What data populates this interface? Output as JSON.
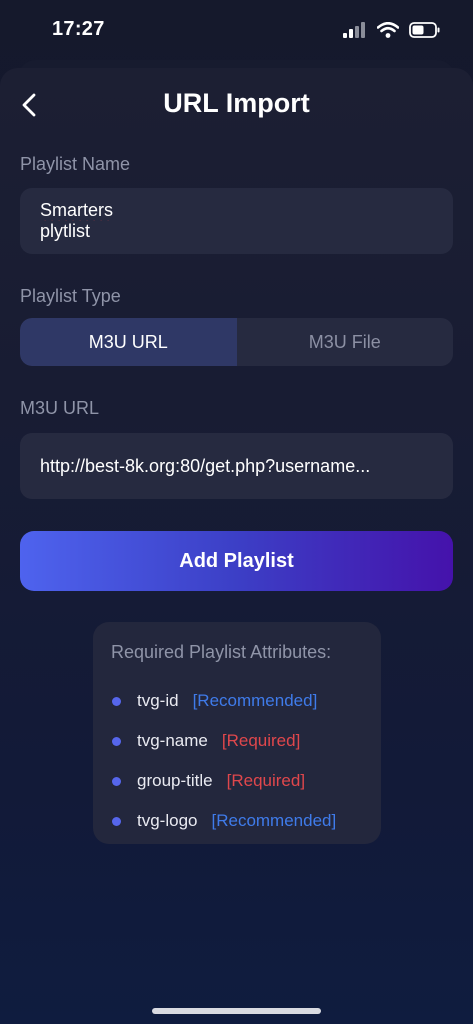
{
  "status_bar": {
    "time": "17:27"
  },
  "header": {
    "title": "URL Import",
    "back_icon": "chevron-left-icon"
  },
  "playlist_name": {
    "label": "Playlist Name",
    "value_word1": "Smarters",
    "value_rest": " plytlist"
  },
  "playlist_type": {
    "label": "Playlist Type",
    "options": [
      "M3U URL",
      "M3U File"
    ],
    "selected": "M3U URL"
  },
  "m3u_url": {
    "label": "M3U URL",
    "value": "http://best-8k.org:80/get.php?username..."
  },
  "add_button": {
    "label": "Add Playlist"
  },
  "attributes": {
    "title": "Required Playlist Attributes:",
    "items": [
      {
        "name": "tvg-id",
        "tag": "[Recommended]"
      },
      {
        "name": "tvg-name",
        "tag": "[Required]"
      },
      {
        "name": "group-title",
        "tag": "[Required]"
      },
      {
        "name": "tvg-logo",
        "tag": "[Recommended]"
      }
    ]
  },
  "colors": {
    "accent": "#4e63ee",
    "recommended": "#3f7bea",
    "required": "#e0474c"
  }
}
